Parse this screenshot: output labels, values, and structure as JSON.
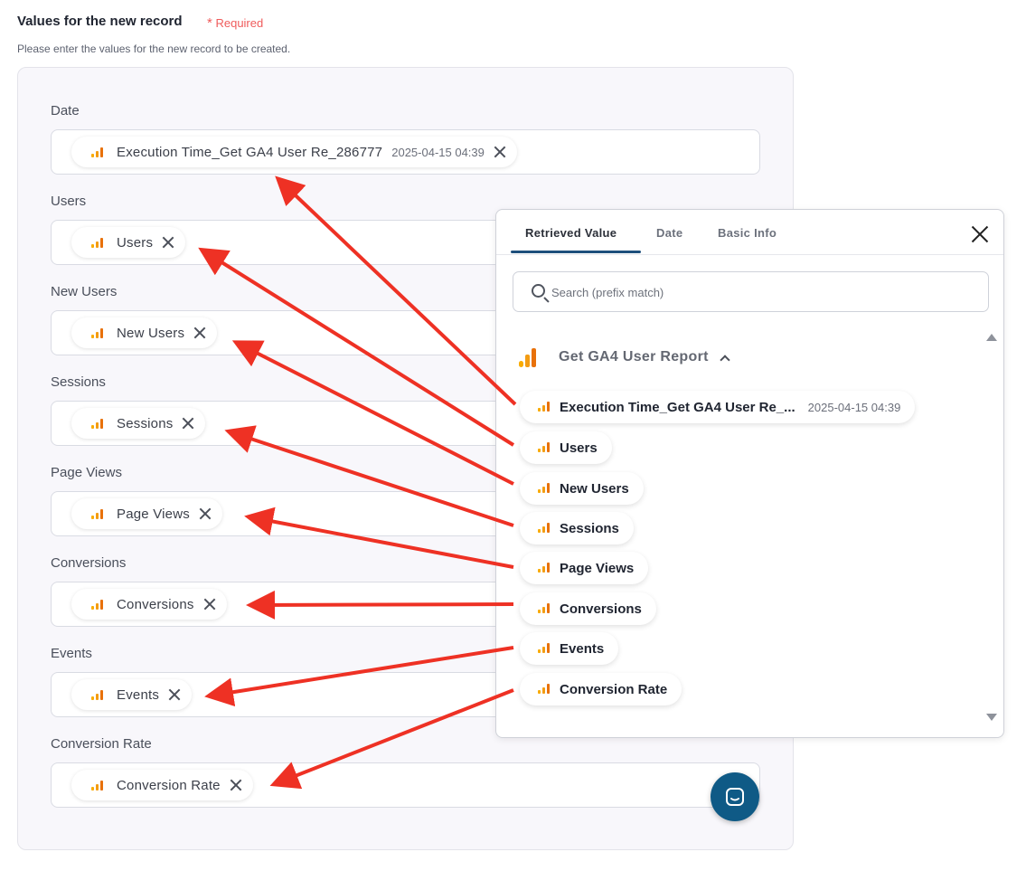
{
  "header": {
    "title": "Values for the new record",
    "required_star": "*",
    "required_label": "Required",
    "description": "Please enter the values for the new record to be created."
  },
  "fields": [
    {
      "label": "Date",
      "chip": "Execution Time_Get GA4 User Re_286777",
      "value": "2025-04-15 04:39"
    },
    {
      "label": "Users",
      "chip": "Users"
    },
    {
      "label": "New Users",
      "chip": "New Users"
    },
    {
      "label": "Sessions",
      "chip": "Sessions"
    },
    {
      "label": "Page Views",
      "chip": "Page Views"
    },
    {
      "label": "Conversions",
      "chip": "Conversions"
    },
    {
      "label": "Events",
      "chip": "Events"
    },
    {
      "label": "Conversion Rate",
      "chip": "Conversion Rate"
    }
  ],
  "popup": {
    "tabs": [
      "Retrieved Value",
      "Date",
      "Basic Info"
    ],
    "active_tab": "Retrieved Value",
    "search_placeholder": "Search (prefix match)",
    "group_title": "Get GA4 User Report",
    "options": [
      {
        "label": "Execution Time_Get GA4 User Re_...",
        "value": "2025-04-15 04:39"
      },
      {
        "label": "Users"
      },
      {
        "label": "New Users"
      },
      {
        "label": "Sessions"
      },
      {
        "label": "Page Views"
      },
      {
        "label": "Conversions"
      },
      {
        "label": "Events"
      },
      {
        "label": "Conversion Rate"
      }
    ]
  },
  "icons": {
    "field_chip": "google-analytics-icon",
    "remove": "close-icon",
    "popup_close": "close-icon",
    "search": "search-icon",
    "group_toggle": "chevron-up-icon",
    "chat": "chat-icon"
  },
  "colors": {
    "required": "#ef5b5b",
    "ga_orange": "#f39c12",
    "ga_orange_light": "#f9ab00",
    "tab_underline": "#1d4f7c",
    "chat_button": "#0f5a86",
    "annotation_arrow": "#ee3124"
  }
}
